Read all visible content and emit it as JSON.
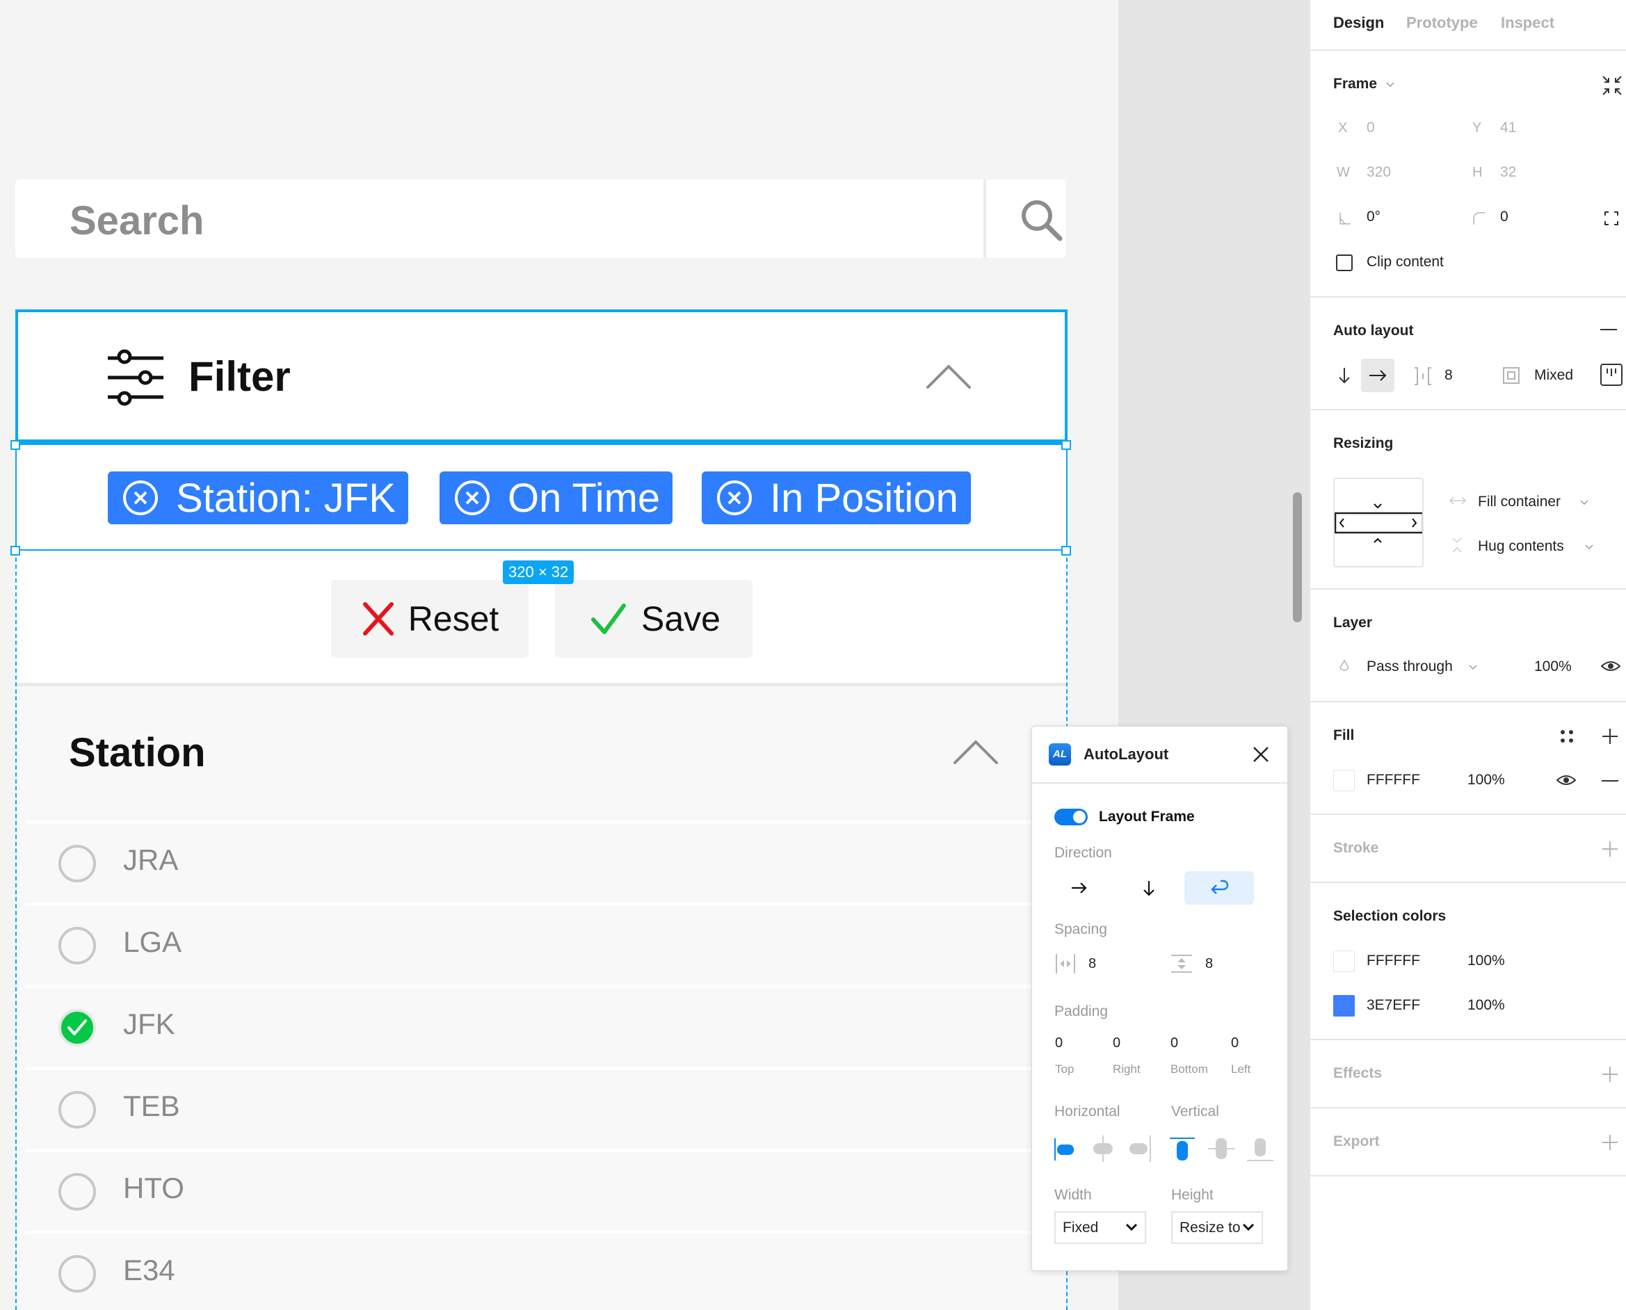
{
  "canvas": {
    "search": {
      "placeholder": "Search",
      "icon": "search-icon"
    },
    "filter": {
      "title": "Filter",
      "icon": "sliders-icon",
      "chips": [
        {
          "label": "Station: JFK",
          "icon": "close-circle-icon"
        },
        {
          "label": "On Time",
          "icon": "close-circle-icon"
        },
        {
          "label": "In Position",
          "icon": "close-circle-icon"
        }
      ],
      "chip_color": "#2E7EFF"
    },
    "selection": {
      "size_label": "320 × 32",
      "color": "#0AA6F5"
    },
    "actions": {
      "reset_label": "Reset",
      "save_label": "Save"
    },
    "station": {
      "title": "Station",
      "items": [
        {
          "label": "JRA",
          "checked": false
        },
        {
          "label": "LGA",
          "checked": false
        },
        {
          "label": "JFK",
          "checked": true
        },
        {
          "label": "TEB",
          "checked": false
        },
        {
          "label": "HTO",
          "checked": false
        },
        {
          "label": "E34",
          "checked": false
        }
      ]
    }
  },
  "plugin": {
    "title": "AutoLayout",
    "logo": "AL",
    "toggle_label": "Layout Frame",
    "toggle_on": true,
    "direction_label": "Direction",
    "directions": [
      "horizontal",
      "vertical",
      "wrap"
    ],
    "direction_selected": "wrap",
    "spacing_label": "Spacing",
    "spacing_horizontal": "8",
    "spacing_vertical": "8",
    "padding_label": "Padding",
    "padding": [
      {
        "value": "0",
        "label": "Top"
      },
      {
        "value": "0",
        "label": "Right"
      },
      {
        "value": "0",
        "label": "Bottom"
      },
      {
        "value": "0",
        "label": "Left"
      }
    ],
    "horizontal_label": "Horizontal",
    "vertical_label": "Vertical",
    "horizontal_selected": "left",
    "vertical_selected": "top",
    "width_label": "Width",
    "width_value": "Fixed",
    "height_label": "Height",
    "height_value": "Resize to"
  },
  "panel": {
    "tabs": [
      "Design",
      "Prototype",
      "Inspect"
    ],
    "active_tab": "Design",
    "frame": {
      "title": "Frame",
      "x_label": "X",
      "x": "0",
      "y_label": "Y",
      "y": "41",
      "w_label": "W",
      "w": "320",
      "h_label": "H",
      "h": "32",
      "rotation": "0°",
      "radius": "0",
      "clip_label": "Clip content",
      "clip_checked": false
    },
    "auto_layout": {
      "title": "Auto layout",
      "spacing": "8",
      "padding": "Mixed"
    },
    "resizing": {
      "title": "Resizing",
      "horizontal": "Fill container",
      "vertical": "Hug contents"
    },
    "layer": {
      "title": "Layer",
      "blend": "Pass through",
      "opacity": "100%"
    },
    "fill": {
      "title": "Fill",
      "color": "FFFFFF",
      "opacity": "100%"
    },
    "stroke": {
      "title": "Stroke"
    },
    "selection_colors": {
      "title": "Selection colors",
      "items": [
        {
          "hex": "FFFFFF",
          "opacity": "100%",
          "swatch": "#FFFFFF"
        },
        {
          "hex": "3E7EFF",
          "opacity": "100%",
          "swatch": "#3E7EFF"
        }
      ]
    },
    "effects": {
      "title": "Effects"
    },
    "export": {
      "title": "Export"
    }
  }
}
